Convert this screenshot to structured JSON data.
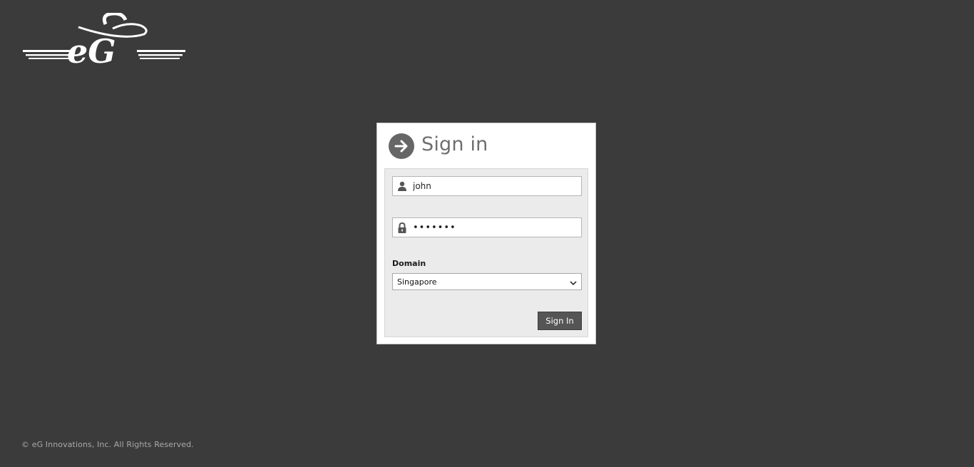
{
  "logo": {
    "text": "eG",
    "icon": "eg-logo"
  },
  "signin": {
    "title": "Sign in",
    "icon": "arrow-right-circle-icon",
    "username": {
      "value": "john",
      "icon": "user-icon"
    },
    "password": {
      "value": "•••••••",
      "icon": "lock-icon"
    },
    "domain": {
      "label": "Domain",
      "selected": "Singapore",
      "icon": "chevron-down-icon"
    },
    "submit_label": "Sign In"
  },
  "footer": {
    "copyright": "© eG Innovations, Inc. All Rights Reserved."
  },
  "colors": {
    "background": "#3b3b3b",
    "button": "#555555",
    "panel": "#ebebeb",
    "title": "#6e6e6e"
  }
}
